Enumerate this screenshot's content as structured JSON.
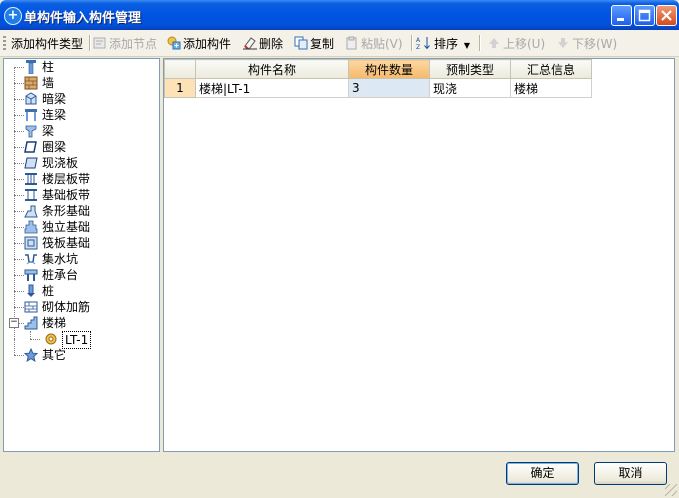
{
  "window": {
    "title": "单构件输入构件管理"
  },
  "toolbar": {
    "add_type": "添加构件类型",
    "add_node": "添加节点",
    "add_component": "添加构件",
    "delete": "删除",
    "copy": "复制",
    "paste": "粘贴(V)",
    "sort": "排序",
    "move_up": "上移(U)",
    "move_down": "下移(W)"
  },
  "tree": {
    "items": [
      {
        "label": "柱",
        "icon": "column-icon"
      },
      {
        "label": "墙",
        "icon": "wall-icon"
      },
      {
        "label": "暗梁",
        "icon": "hidden-beam-icon"
      },
      {
        "label": "连梁",
        "icon": "link-beam-icon"
      },
      {
        "label": "梁",
        "icon": "beam-icon"
      },
      {
        "label": "圈梁",
        "icon": "ring-beam-icon"
      },
      {
        "label": "现浇板",
        "icon": "slab-icon"
      },
      {
        "label": "楼层板带",
        "icon": "floor-strip-icon"
      },
      {
        "label": "基础板带",
        "icon": "foundation-strip-icon"
      },
      {
        "label": "条形基础",
        "icon": "strip-foundation-icon"
      },
      {
        "label": "独立基础",
        "icon": "isolated-foundation-icon"
      },
      {
        "label": "筏板基础",
        "icon": "raft-foundation-icon"
      },
      {
        "label": "集水坑",
        "icon": "sump-icon"
      },
      {
        "label": "桩承台",
        "icon": "pile-cap-icon"
      },
      {
        "label": "桩",
        "icon": "pile-icon"
      },
      {
        "label": "砌体加筋",
        "icon": "masonry-rebar-icon"
      },
      {
        "label": "楼梯",
        "icon": "stair-icon"
      },
      {
        "label": "LT-1",
        "icon": "component-gear-icon"
      },
      {
        "label": "其它",
        "icon": "other-star-icon"
      }
    ]
  },
  "grid": {
    "columns": [
      "构件名称",
      "构件数量",
      "预制类型",
      "汇总信息"
    ],
    "rows": [
      {
        "num": "1",
        "name": "楼梯|LT-1",
        "qty": "3",
        "type": "现浇",
        "summary": "楼梯"
      }
    ]
  },
  "buttons": {
    "ok": "确定",
    "cancel": "取消"
  },
  "colors": {
    "titlebar": "#0054e3",
    "active_header": "#f6b96b",
    "row_header": "#fde2b8"
  }
}
